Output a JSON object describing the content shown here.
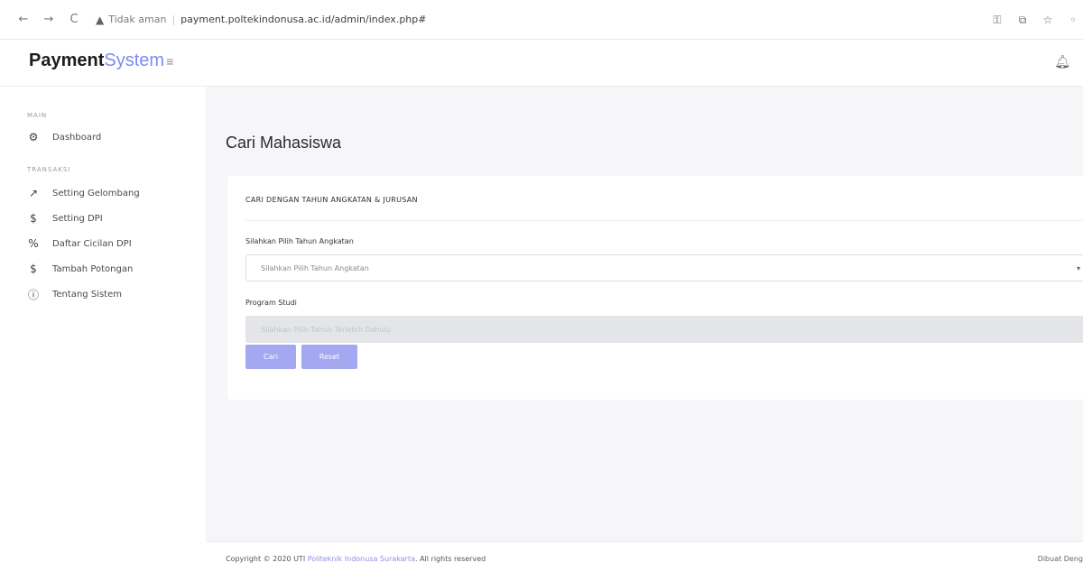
{
  "browser": {
    "back_glyph": "←",
    "forward_glyph": "→",
    "reload_glyph": "C",
    "security_label": "Tidak aman",
    "url": "payment.poltekindonusa.ac.id/admin/index.php#"
  },
  "header": {
    "logo_strong": "Payment",
    "logo_light": "System"
  },
  "sidebar": {
    "main_heading": "MAIN",
    "dashboard_label": "Dashboard",
    "transaksi_heading": "TRANSAKSI",
    "items": [
      {
        "label": "Setting Gelombang",
        "icon": "trend-icon"
      },
      {
        "label": "Setting DPI",
        "icon": "dollar-icon"
      },
      {
        "label": "Daftar Cicilan DPI",
        "icon": "percent-icon"
      },
      {
        "label": "Tambah Potongan",
        "icon": "dollar-icon"
      },
      {
        "label": "Tentang Sistem",
        "icon": "info-icon"
      }
    ]
  },
  "main": {
    "page_title": "Cari Mahasiswa",
    "card_title": "CARI DENGAN TAHUN ANGKATAN & JURUSAN",
    "tahun_label": "Silahkan Pilih Tahun Angkatan",
    "tahun_select_value": "Silahkan Pilih Tahun Angkatan",
    "prodi_label": "Program Studi",
    "prodi_select_value": "Silahkan Pilih Tahun Terlebih Dahulu",
    "cari_button": "Cari",
    "reset_button": "Reset"
  },
  "footer": {
    "copyright_prefix": "Copyright © 2020 UTI",
    "copyright_link": "Politeknik Indonusa Surakarta",
    "copyright_suffix": ". All rights reserved",
    "right_text": "Dibuat Deng"
  },
  "colors": {
    "accent": "#7b8cf0",
    "button": "#a3a8f0",
    "background": "#f6f6f8"
  }
}
